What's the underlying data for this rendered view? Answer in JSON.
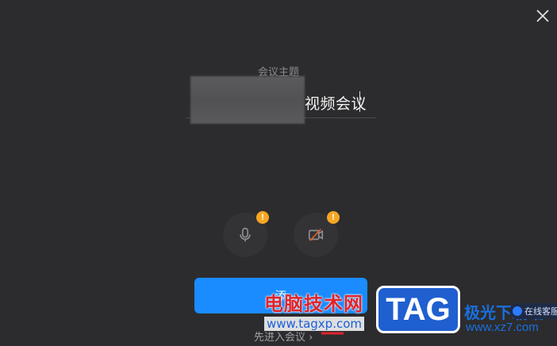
{
  "dialog": {
    "close_icon": "close-icon",
    "topic_label": "会议主题",
    "topic_value": "视频会议"
  },
  "media": {
    "mic_icon": "microphone-icon",
    "camera_icon": "camera-off-icon",
    "mic_warning": "!",
    "camera_warning": "!"
  },
  "actions": {
    "join_label": "添",
    "enter_first_label": "先进入会议 ›"
  },
  "watermark": {
    "site_name": "电脑技术网",
    "url": "www.tagxp.com",
    "tag": "TAG",
    "logo_top": "极光下载站",
    "logo_bottom": "www.xz7.com",
    "support_label": "在线客服"
  },
  "colors": {
    "background": "#2c2c2e",
    "primary_button": "#1a8cff",
    "warning_badge": "#f5a623"
  }
}
